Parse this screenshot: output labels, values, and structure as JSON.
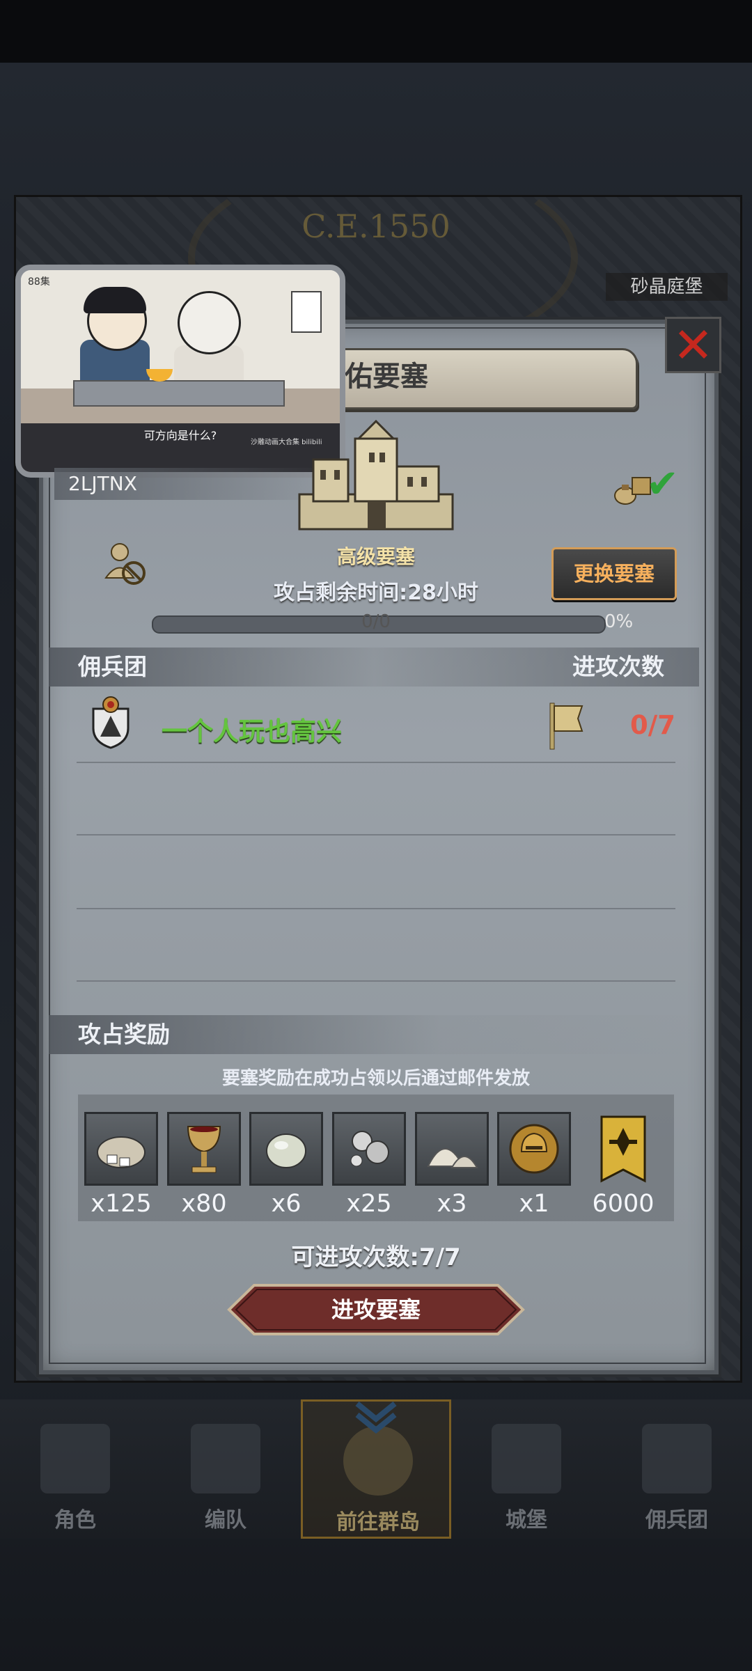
{
  "header": {
    "era": "C.E.1550",
    "location": "砂晶庭堡"
  },
  "video": {
    "episode": "88集",
    "subtitle": "可方向是什么?",
    "credit": "沙雕动画大合集 bilibili"
  },
  "panel": {
    "title": "圣佑要塞",
    "player_id": "2LJTNX",
    "fortress_type": "高级要塞",
    "switch_label": "更换要塞",
    "time_label": "攻占剩余时间:28小时",
    "progress_text": "0/0",
    "progress_pct": "0%",
    "progress_value": 0,
    "guild_header": "佣兵团",
    "attacks_header": "进攻次数",
    "guild_name": "一个人玩也高兴",
    "guild_attacks": "0/7",
    "rewards_header": "攻占奖励",
    "rewards_note": "要塞奖励在成功占领以后通过邮件发放",
    "rewards": [
      {
        "icon": "cloth-bundle-icon",
        "qty": "x125"
      },
      {
        "icon": "goblet-icon",
        "qty": "x80"
      },
      {
        "icon": "gem-stone-icon",
        "qty": "x6"
      },
      {
        "icon": "silver-ore-icon",
        "qty": "x25"
      },
      {
        "icon": "salt-pile-icon",
        "qty": "x3"
      },
      {
        "icon": "golden-helmet-icon",
        "qty": "x1"
      },
      {
        "icon": "guild-banner-icon",
        "qty": "6000"
      }
    ],
    "remaining_attacks": "可进攻次数:7/7",
    "attack_button": "进攻要塞"
  },
  "nav": [
    {
      "label": "角色",
      "icon": "knight-icon"
    },
    {
      "label": "编队",
      "icon": "formation-icon"
    },
    {
      "label": "前往群岛",
      "icon": "globe-icon",
      "active": true
    },
    {
      "label": "城堡",
      "icon": "castle-icon"
    },
    {
      "label": "佣兵团",
      "icon": "mercenary-icon"
    }
  ],
  "colors": {
    "accent": "#f6b05d",
    "guild": "#64c43f",
    "danger": "#e25a4a",
    "attack_button": "#6e2d2a"
  }
}
